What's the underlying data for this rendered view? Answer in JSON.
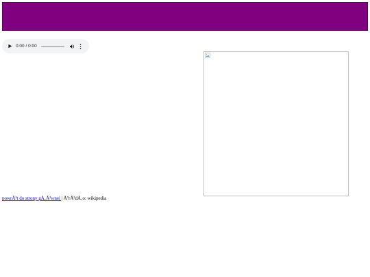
{
  "banner": {
    "color": "#800080"
  },
  "audio_player": {
    "time": "0:00 / 0:00",
    "progress": 0,
    "icons": {
      "play": "play-icon",
      "volume": "volume-icon",
      "menu": "more-vertical-icon"
    }
  },
  "image": {
    "icon": "broken-image-icon"
  },
  "footer": {
    "link_text": "powrÃ³t do strony gÅ‚Ã³wnej",
    "separator": " |",
    "source_text": " ÅºrÃ³dÅ‚o: wikipedia",
    "link_color": "#0000ee"
  }
}
